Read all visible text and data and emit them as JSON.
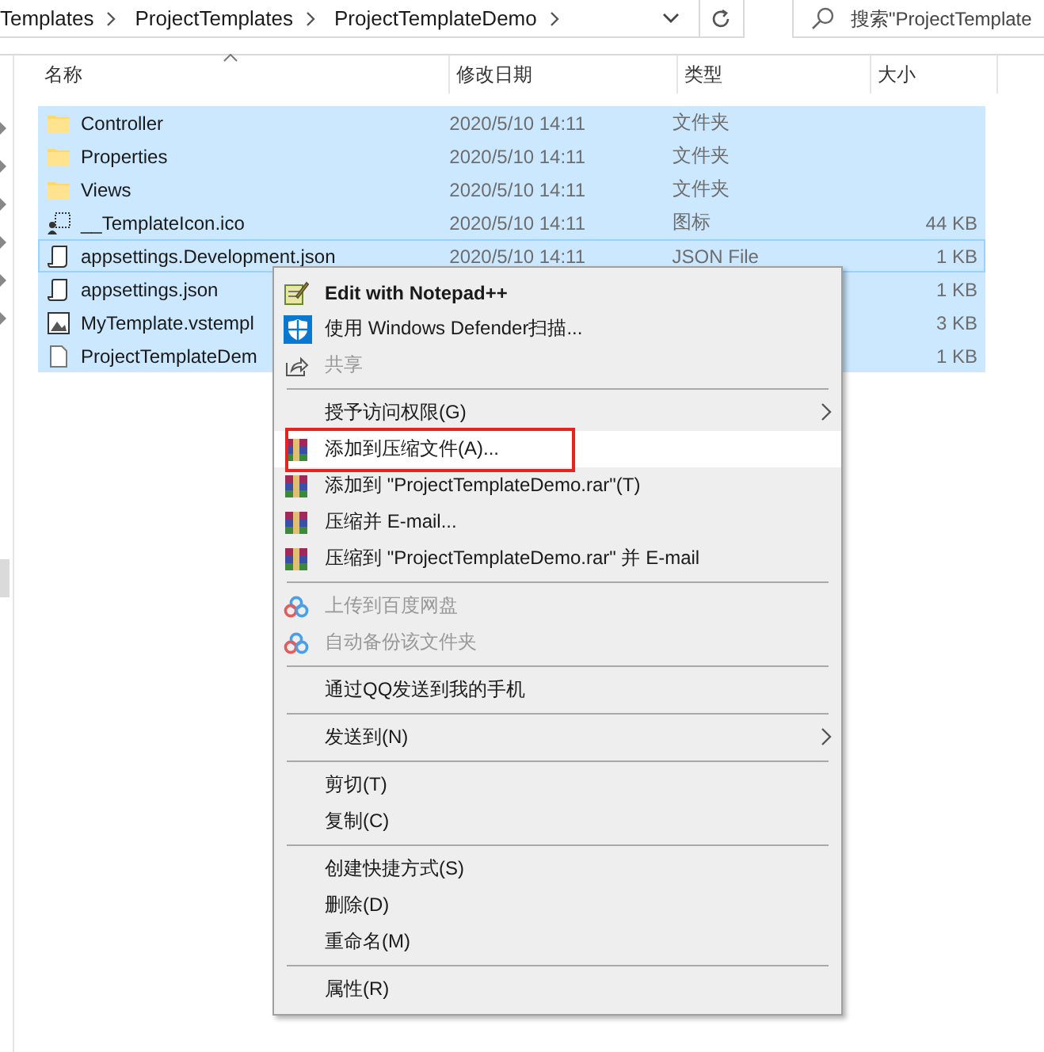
{
  "address_bar": {
    "breadcrumbs": [
      {
        "label": "Templates"
      },
      {
        "label": "ProjectTemplates"
      },
      {
        "label": "ProjectTemplateDemo"
      }
    ],
    "search": {
      "placeholder": "搜索\"ProjectTemplate"
    }
  },
  "file_list": {
    "columns": [
      {
        "label": "名称",
        "sorted": true
      },
      {
        "label": "修改日期",
        "sorted": false
      },
      {
        "label": "类型",
        "sorted": false
      },
      {
        "label": "大小",
        "sorted": false
      }
    ],
    "rows": [
      {
        "name": "Controller",
        "date": "2020/5/10 14:11",
        "type": "文件夹",
        "selected": true,
        "focused": false
      },
      {
        "name": "Properties",
        "date": "2020/5/10 14:11",
        "type": "文件夹",
        "selected": true,
        "focused": false
      },
      {
        "name": "Views",
        "date": "2020/5/10 14:11",
        "type": "文件夹",
        "selected": true,
        "focused": false
      },
      {
        "name": "__TemplateIcon.ico",
        "date": "2020/5/10 14:11",
        "type": "图标",
        "size": "44 KB",
        "selected": true,
        "focused": false
      },
      {
        "name": "appsettings.Development.json",
        "date": "2020/5/10 14:11",
        "type": "JSON File",
        "size": "1 KB",
        "selected": true,
        "focused": true
      },
      {
        "name": "appsettings.json",
        "size": "1 KB",
        "selected": true,
        "focused": false
      },
      {
        "name": "MyTemplate.vstempl",
        "size": "3 KB",
        "selected": true,
        "focused": false
      },
      {
        "name": "ProjectTemplateDem",
        "size": "1 KB",
        "selected": true,
        "focused": false
      }
    ]
  },
  "context_menu": {
    "items": [
      {
        "kind": "item",
        "label": "Edit with Notepad++",
        "bold": true,
        "disabled": false,
        "submenu": false,
        "selected": false,
        "outlined": false
      },
      {
        "kind": "item",
        "label": "使用 Windows Defender扫描...",
        "bold": false,
        "disabled": false,
        "submenu": false,
        "selected": false,
        "outlined": false
      },
      {
        "kind": "item",
        "label": "共享",
        "bold": false,
        "disabled": true,
        "submenu": false,
        "selected": false,
        "outlined": false
      },
      {
        "kind": "separator"
      },
      {
        "kind": "item",
        "label": "授予访问权限(G)",
        "bold": false,
        "disabled": false,
        "submenu": true,
        "selected": false,
        "outlined": false
      },
      {
        "kind": "item",
        "label": "添加到压缩文件(A)...",
        "bold": false,
        "disabled": false,
        "submenu": false,
        "selected": true,
        "outlined": true
      },
      {
        "kind": "item",
        "label": "添加到 \"ProjectTemplateDemo.rar\"(T)",
        "bold": false,
        "disabled": false,
        "submenu": false,
        "selected": false,
        "outlined": false
      },
      {
        "kind": "item",
        "label": "压缩并 E-mail...",
        "bold": false,
        "disabled": false,
        "submenu": false,
        "selected": false,
        "outlined": false
      },
      {
        "kind": "item",
        "label": "压缩到 \"ProjectTemplateDemo.rar\" 并 E-mail",
        "bold": false,
        "disabled": false,
        "submenu": false,
        "selected": false,
        "outlined": false
      },
      {
        "kind": "separator"
      },
      {
        "kind": "item",
        "label": "上传到百度网盘",
        "bold": false,
        "disabled": true,
        "submenu": false,
        "selected": false,
        "outlined": false
      },
      {
        "kind": "item",
        "label": "自动备份该文件夹",
        "bold": false,
        "disabled": true,
        "submenu": false,
        "selected": false,
        "outlined": false
      },
      {
        "kind": "separator"
      },
      {
        "kind": "item",
        "label": "通过QQ发送到我的手机",
        "bold": false,
        "disabled": false,
        "submenu": false,
        "selected": false,
        "outlined": false
      },
      {
        "kind": "separator"
      },
      {
        "kind": "item",
        "label": "发送到(N)",
        "bold": false,
        "disabled": false,
        "submenu": true,
        "selected": false,
        "outlined": false
      },
      {
        "kind": "separator"
      },
      {
        "kind": "item",
        "label": "剪切(T)",
        "bold": false,
        "disabled": false,
        "submenu": false,
        "selected": false,
        "outlined": false
      },
      {
        "kind": "item",
        "label": "复制(C)",
        "bold": false,
        "disabled": false,
        "submenu": false,
        "selected": false,
        "outlined": false
      },
      {
        "kind": "separator"
      },
      {
        "kind": "item",
        "label": "创建快捷方式(S)",
        "bold": false,
        "disabled": false,
        "submenu": false,
        "selected": false,
        "outlined": false
      },
      {
        "kind": "item",
        "label": "删除(D)",
        "bold": false,
        "disabled": false,
        "submenu": false,
        "selected": false,
        "outlined": false
      },
      {
        "kind": "item",
        "label": "重命名(M)",
        "bold": false,
        "disabled": false,
        "submenu": false,
        "selected": false,
        "outlined": false
      },
      {
        "kind": "separator"
      },
      {
        "kind": "item",
        "label": "属性(R)",
        "bold": false,
        "disabled": false,
        "submenu": false,
        "selected": false,
        "outlined": false
      }
    ]
  }
}
